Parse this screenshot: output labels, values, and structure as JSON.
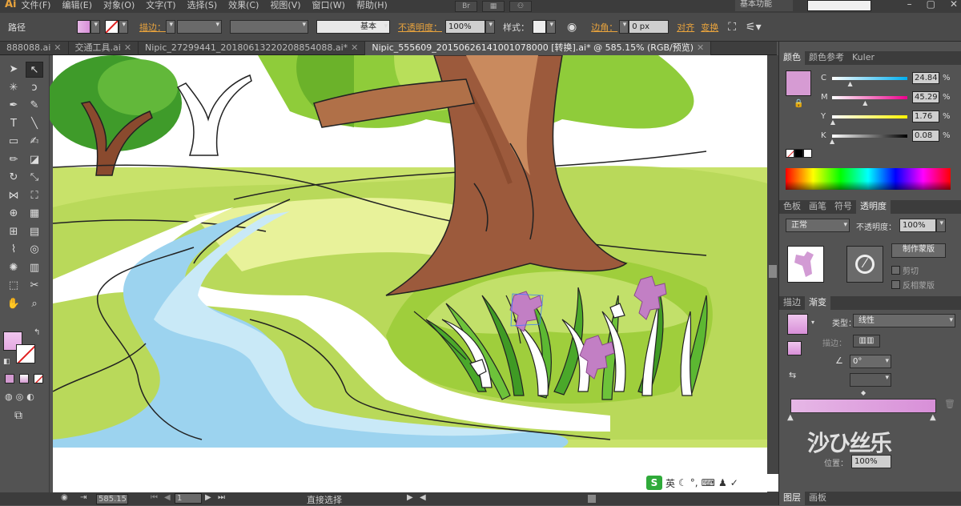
{
  "app": {
    "logo": "Ai",
    "menu": [
      "文件(F)",
      "编辑(E)",
      "对象(O)",
      "文字(T)",
      "选择(S)",
      "效果(C)",
      "视图(V)",
      "窗口(W)",
      "帮助(H)"
    ],
    "workspace": "基本功能"
  },
  "control_bar": {
    "object_type": "路径",
    "stroke_label": "描边：",
    "brush_label": "基本",
    "opacity_label": "不透明度：",
    "opacity_value": "100%",
    "style_label": "样式：",
    "corner_label": "边角：",
    "corner_value": "0 px",
    "align_label": "对齐",
    "transform_label": "变换"
  },
  "tabs": [
    {
      "label": "888088.ai",
      "active": false
    },
    {
      "label": "交通工具.ai",
      "active": false
    },
    {
      "label": "Nipic_27299441_20180613220208854088.ai*",
      "active": false
    },
    {
      "label": "Nipic_555609_20150626141001078000 [转换].ai* @ 585.15% (RGB/预览)",
      "active": true
    }
  ],
  "tools": [
    {
      "name": "selection-tool",
      "glyph": "➤"
    },
    {
      "name": "direct-selection-tool",
      "glyph": "↖"
    },
    {
      "name": "magic-wand-tool",
      "glyph": "✳"
    },
    {
      "name": "lasso-tool",
      "glyph": "ↄ"
    },
    {
      "name": "pen-tool",
      "glyph": "✒"
    },
    {
      "name": "curvature-tool",
      "glyph": "✎"
    },
    {
      "name": "type-tool",
      "glyph": "T"
    },
    {
      "name": "line-tool",
      "glyph": "╲"
    },
    {
      "name": "rectangle-tool",
      "glyph": "▭"
    },
    {
      "name": "paintbrush-tool",
      "glyph": "✍"
    },
    {
      "name": "pencil-tool",
      "glyph": "✏"
    },
    {
      "name": "eraser-tool",
      "glyph": "◪"
    },
    {
      "name": "rotate-tool",
      "glyph": "↻"
    },
    {
      "name": "scale-tool",
      "glyph": "⤡"
    },
    {
      "name": "width-tool",
      "glyph": "⋈"
    },
    {
      "name": "free-transform-tool",
      "glyph": "⛶"
    },
    {
      "name": "shape-builder-tool",
      "glyph": "⊕"
    },
    {
      "name": "perspective-grid-tool",
      "glyph": "▦"
    },
    {
      "name": "mesh-tool",
      "glyph": "⊞"
    },
    {
      "name": "gradient-tool",
      "glyph": "▤"
    },
    {
      "name": "eyedropper-tool",
      "glyph": "⌇"
    },
    {
      "name": "blend-tool",
      "glyph": "◎"
    },
    {
      "name": "symbol-sprayer-tool",
      "glyph": "✺"
    },
    {
      "name": "column-graph-tool",
      "glyph": "▥"
    },
    {
      "name": "artboard-tool",
      "glyph": "⬚"
    },
    {
      "name": "slice-tool",
      "glyph": "✂"
    },
    {
      "name": "hand-tool",
      "glyph": "✋"
    },
    {
      "name": "zoom-tool",
      "glyph": "⌕"
    }
  ],
  "color_panel": {
    "tabs": [
      "颜色",
      "颜色参考",
      "Kuler"
    ],
    "cmyk": [
      {
        "label": "C",
        "value": "24.84",
        "fraction": 0.25
      },
      {
        "label": "M",
        "value": "45.29",
        "fraction": 0.45
      },
      {
        "label": "Y",
        "value": "1.76",
        "fraction": 0.02
      },
      {
        "label": "K",
        "value": "0.08",
        "fraction": 0.01
      }
    ],
    "fill_color": "#d69bd3"
  },
  "transparency_panel": {
    "tabs": [
      "色板",
      "画笔",
      "符号",
      "透明度"
    ],
    "blend_mode": "正常",
    "opacity_label": "不透明度：",
    "opacity_value": "100%",
    "make_mask": "制作蒙版",
    "clip": "剪切",
    "invert": "反相蒙版"
  },
  "gradient_panel": {
    "tabs": [
      "描边",
      "渐变"
    ],
    "type_label": "类型：",
    "type_value": "线性",
    "stroke_label": "描边：",
    "angle_value": "0°",
    "position_label": "位置：",
    "position_value": "100%",
    "start_color": "#e6b7e6",
    "end_color": "#d88fd8"
  },
  "bottom_tabs": [
    "图层",
    "画板"
  ],
  "status": {
    "zoom": "585.15",
    "page": "1",
    "tool_label": "直接选择"
  },
  "ime": {
    "logo": "S",
    "lang": "英"
  },
  "watermark": "沙ひ丝乐"
}
